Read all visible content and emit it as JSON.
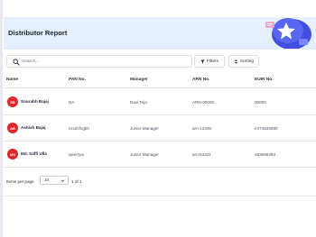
{
  "page": {
    "title": "Distributor Report"
  },
  "search": {
    "placeholder": "Search..."
  },
  "toolbar": {
    "filters_label": "Filters",
    "sorting_label": "Sorting"
  },
  "table": {
    "headers": [
      "Name",
      "PAN No.",
      "Manager",
      "ARN No.",
      "EUIN No."
    ],
    "rows": [
      {
        "initials": "SB",
        "name": "Sourabh Bajaj",
        "pan": "NA",
        "manager": "Ravi Teja",
        "arn": "ARN-00000",
        "euin": "00000"
      },
      {
        "initials": "AB",
        "name": "Ashish Bajaj",
        "pan": "cxxdcfvgbh",
        "manager": "Junior Manager",
        "arn": "arn-12345",
        "euin": "e374833680"
      },
      {
        "initials": "MS",
        "name": "Md. Saffi Ulla",
        "pan": "qwertyui",
        "manager": "Junior Manager",
        "arn": "arn-54321",
        "euin": "e83698493"
      }
    ]
  },
  "pagination": {
    "label": "Items per page",
    "page_size": "10",
    "range": "1 of 1"
  },
  "colors": {
    "accent": "#e0262a",
    "header_bg": "#e5efff"
  },
  "icons": {
    "search": "search-icon",
    "filters": "filter-icon",
    "sorting": "sort-icon",
    "dropdown": "chevron-down-icon"
  }
}
